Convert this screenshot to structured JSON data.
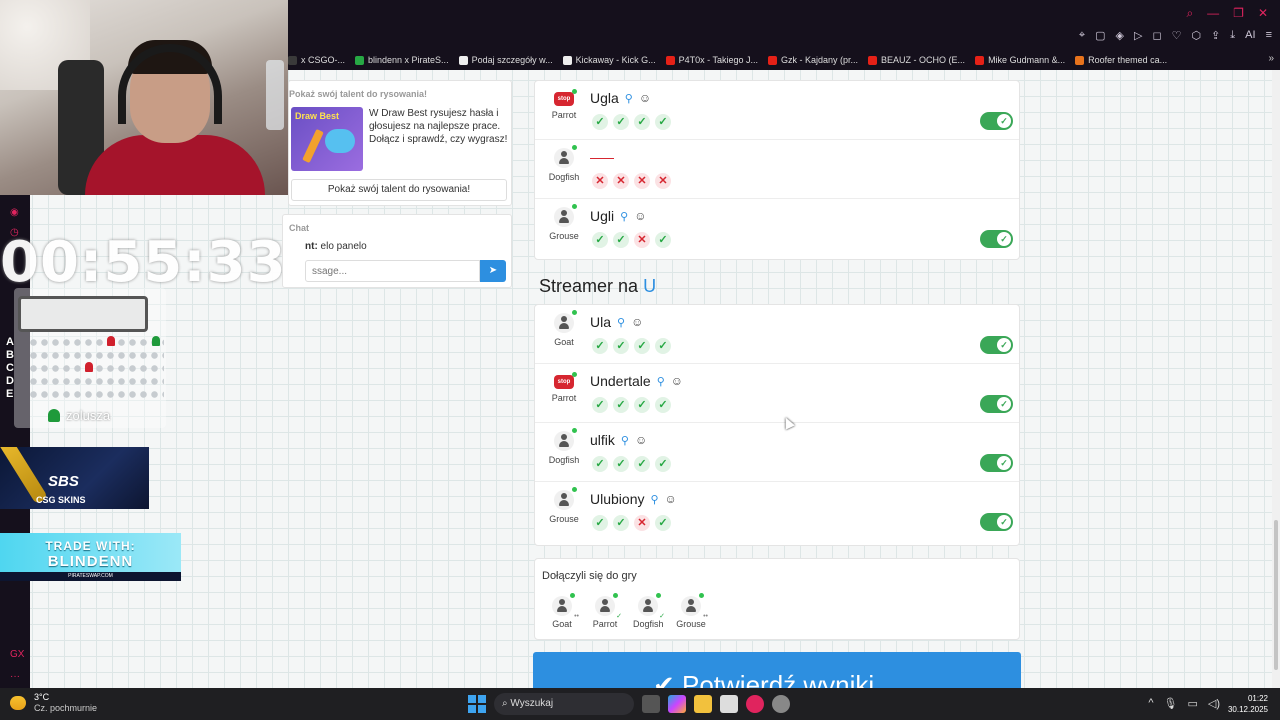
{
  "browser": {
    "bookmarks": [
      {
        "label": "x CSGO-...",
        "color": "#3a3a3a"
      },
      {
        "label": "blindenn x PirateS...",
        "color": "#27a844"
      },
      {
        "label": "Podaj szczegóły w...",
        "color": "#eeeeee"
      },
      {
        "label": "Kickaway - Kick G...",
        "color": "#eeeeee"
      },
      {
        "label": "P4T0x - Takiego J...",
        "color": "#e62117"
      },
      {
        "label": "Gzk - Kajdany (pr...",
        "color": "#e62117"
      },
      {
        "label": "BEAUZ - OCHO (E...",
        "color": "#e62117"
      },
      {
        "label": "Mike Gudmann &...",
        "color": "#e62117"
      },
      {
        "label": "Roofer themed ca...",
        "color": "#e8731c"
      }
    ],
    "toolbar_ai": "AI"
  },
  "overlay": {
    "timer": "00:55:33",
    "row_labels": [
      "A",
      "B",
      "C",
      "D",
      "E"
    ],
    "username": "zolusza",
    "csg_logo": "SBS",
    "csg_sub": "CSG SKINS",
    "trade_line1": "TRADE WITH:",
    "trade_line2": "BLINDENN",
    "trade_line3": "PIRATESWAP.COM"
  },
  "ad": {
    "header": "Pokaż swój talent do rysowania!",
    "image_label": "Draw Best",
    "text": "W Draw Best rysujesz hasła i głosujesz na najlepsze prace. Dołącz i sprawdź, czy wygrasz!",
    "button": "Pokaż swój talent do rysowania!"
  },
  "chat": {
    "title": "Chat",
    "msg_user": "nt:",
    "msg_text": " elo panelo",
    "placeholder": "ssage..."
  },
  "previous_rows": [
    {
      "player": "Parrot",
      "avatar": "stop",
      "answer": "Ugla",
      "votes": [
        "yes",
        "yes",
        "yes",
        "yes"
      ],
      "accepted": true
    },
    {
      "player": "Dogfish",
      "avatar": "person",
      "answer": "",
      "votes": [
        "no",
        "no",
        "no",
        "no"
      ],
      "accepted": false
    },
    {
      "player": "Grouse",
      "avatar": "person",
      "answer": "Ugli",
      "votes": [
        "yes",
        "yes",
        "no",
        "yes"
      ],
      "accepted": true
    }
  ],
  "section": {
    "title": "Streamer na",
    "letter": "U"
  },
  "rows": [
    {
      "player": "Goat",
      "avatar": "person",
      "answer": "Ula",
      "votes": [
        "yes",
        "yes",
        "yes",
        "yes"
      ],
      "accepted": true
    },
    {
      "player": "Parrot",
      "avatar": "stop",
      "answer": "Undertale",
      "votes": [
        "yes",
        "yes",
        "yes",
        "yes"
      ],
      "accepted": true
    },
    {
      "player": "Dogfish",
      "avatar": "person",
      "answer": "ulfik",
      "votes": [
        "yes",
        "yes",
        "yes",
        "yes"
      ],
      "accepted": true
    },
    {
      "player": "Grouse",
      "avatar": "person",
      "answer": "Ulubiony",
      "votes": [
        "yes",
        "yes",
        "no",
        "yes"
      ],
      "accepted": true
    }
  ],
  "joined": {
    "title": "Dołączyli się do gry",
    "players": [
      "Goat",
      "Parrot",
      "Dogfish",
      "Grouse"
    ]
  },
  "confirm_button": "✔ Potwierdź wyniki",
  "taskbar": {
    "temp": "3°C",
    "weather": "Cz. pochmurnie",
    "search": "Wyszukaj",
    "time": "01:22",
    "date": "30.12.2025"
  }
}
